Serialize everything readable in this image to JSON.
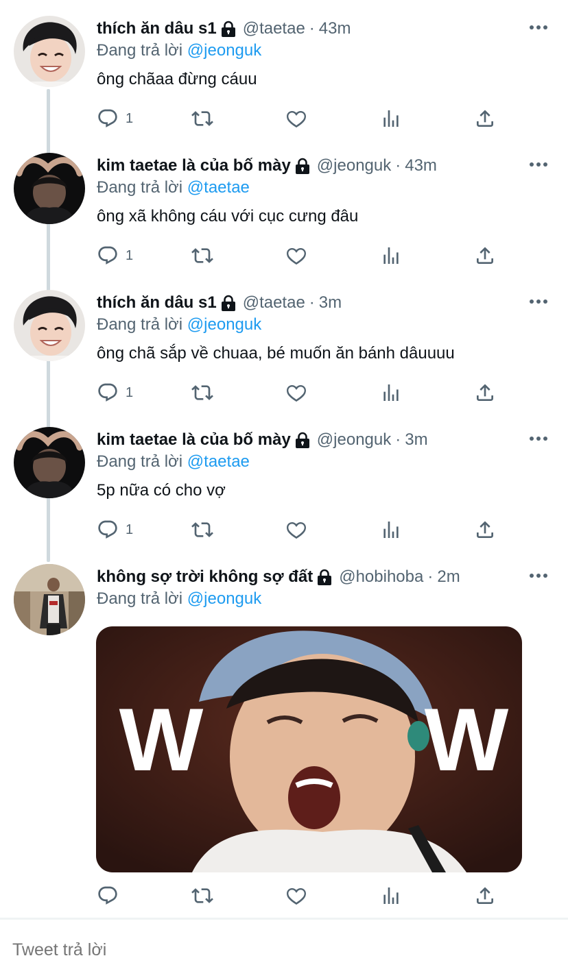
{
  "colors": {
    "accent": "#1d9bf0",
    "secondary_text": "#536471",
    "primary_text": "#0f1419",
    "thread_line": "#cfd9de"
  },
  "replying_prefix": "Đang trả lời",
  "tweets": [
    {
      "display_name": "thích ăn dâu s1",
      "protected": true,
      "handle": "@taetae",
      "time": "43m",
      "reply_to": "@jeonguk",
      "text": "ông chãaa đừng cáuu",
      "reply_count": "1",
      "avatar": "avatar-taetae"
    },
    {
      "display_name": "kim taetae là của bố mày",
      "protected": true,
      "handle": "@jeonguk",
      "time": "43m",
      "reply_to": "@taetae",
      "text": "ông xã không cáu với cục cưng đâu",
      "reply_count": "1",
      "avatar": "avatar-jeonguk"
    },
    {
      "display_name": "thích ăn dâu s1",
      "protected": true,
      "handle": "@taetae",
      "time": "3m",
      "reply_to": "@jeonguk",
      "text": "ông chã sắp về chuaa, bé muốn ăn bánh dâuuuu",
      "reply_count": "1",
      "avatar": "avatar-taetae"
    },
    {
      "display_name": "kim taetae là của bố mày",
      "protected": true,
      "handle": "@jeonguk",
      "time": "3m",
      "reply_to": "@taetae",
      "text": "5p nữa có cho vợ",
      "reply_count": "1",
      "avatar": "avatar-jeonguk"
    },
    {
      "display_name": "không sợ trời không sợ đất",
      "protected": true,
      "handle": "@hobihoba",
      "time": "2m",
      "reply_to": "@jeonguk",
      "text": "",
      "reply_count": "",
      "avatar": "avatar-hobihoba",
      "media": {
        "caption_left": "W",
        "caption_right": "W"
      }
    }
  ],
  "action_icons": [
    "reply-icon",
    "retweet-icon",
    "like-icon",
    "analytics-icon",
    "share-icon"
  ],
  "reply_box": {
    "placeholder": "Tweet trả lời"
  }
}
